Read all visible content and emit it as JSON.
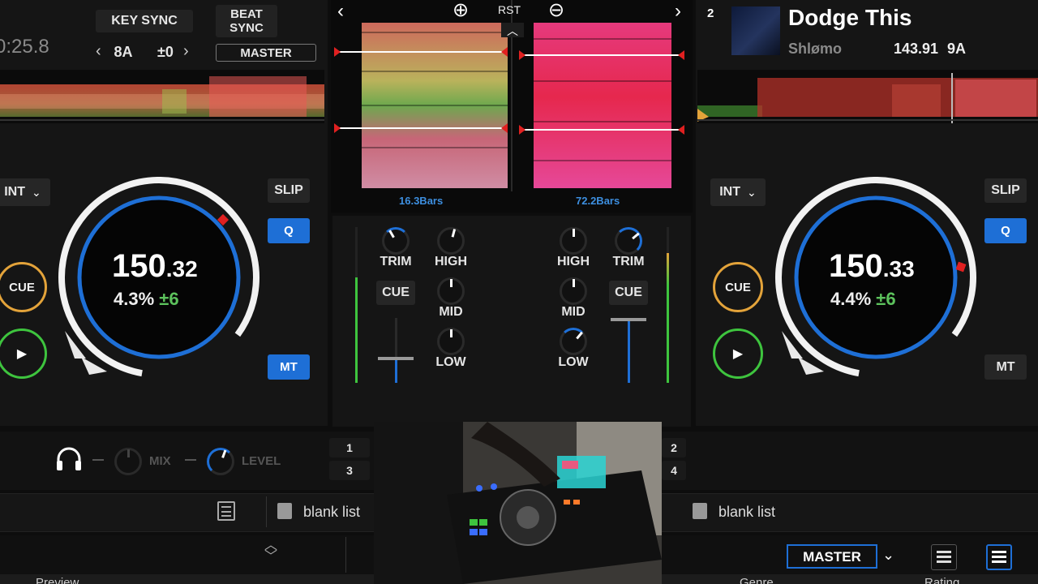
{
  "colors": {
    "accent_blue": "#1e6fd6",
    "cue_orange": "#e3a33a",
    "play_green": "#3ec43e",
    "key_green": "#5cc25c"
  },
  "deck1": {
    "time": "0:25.8",
    "key_sync_label": "KEY SYNC",
    "key": "8A",
    "key_shift": "±0",
    "beat_sync_line1": "BEAT",
    "beat_sync_line2": "SYNC",
    "master_label": "MASTER",
    "int_label": "INT",
    "slip_label": "SLIP",
    "q_label": "Q",
    "mt_label": "MT",
    "cue_label": "CUE",
    "bpm_int": "150",
    "bpm_dec": ".32",
    "pitch": "4.3%",
    "pitch_range": "±6",
    "prev_icon": "chevron-left-icon",
    "next_icon": "chevron-right-icon"
  },
  "deck2": {
    "number": "2",
    "title": "Dodge This",
    "artist": "Shlømo",
    "bpm": "143.91",
    "key": "9A",
    "int_label": "INT",
    "slip_label": "SLIP",
    "q_label": "Q",
    "mt_label": "MT",
    "cue_label": "CUE",
    "bpm_int": "150",
    "bpm_dec": ".33",
    "pitch": "4.4%",
    "pitch_range": "±6"
  },
  "center": {
    "rst_label": "RST",
    "bars_left": "16.3Bars",
    "bars_right": "72.2Bars"
  },
  "mixer": {
    "trim": "TRIM",
    "high": "HIGH",
    "mid": "MID",
    "low": "LOW",
    "cue": "CUE"
  },
  "bottom": {
    "mix_label": "MIX",
    "level_label": "LEVEL",
    "deck_buttons": [
      "1",
      "3",
      "2",
      "4"
    ],
    "blank_list_left": "blank list",
    "blank_list_right": "blank list",
    "master_dropdown": "MASTER",
    "col_preview": "Preview",
    "col_genre": "Genre",
    "col_rating": "Rating"
  }
}
